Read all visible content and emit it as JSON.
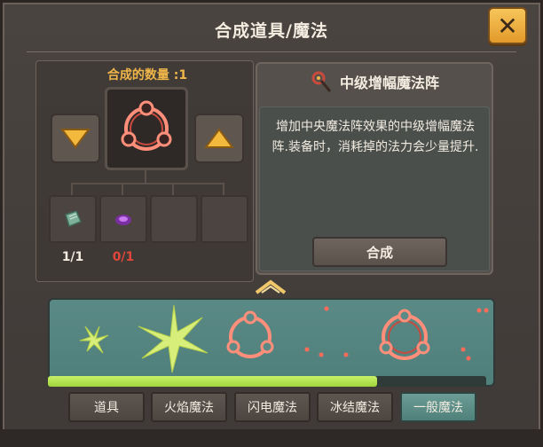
{
  "window": {
    "title": "合成道具/魔法"
  },
  "craft": {
    "quantity_label": "合成的数量 :1",
    "ingredients": [
      {
        "name": "parchment",
        "count": "1/1",
        "count_color": "#f1ebe0"
      },
      {
        "name": "purple-orb",
        "count": "0/1",
        "count_color": "#e0473a"
      },
      {
        "name": "empty-slot",
        "count": ""
      },
      {
        "name": "empty-slot",
        "count": ""
      }
    ]
  },
  "info": {
    "title": "中级增幅魔法阵",
    "description": "增加中央魔法阵效果的中级增幅魔法阵.装备时，消耗掉的法力会少量提升.",
    "compose_label": "合成"
  },
  "gallery": {
    "scroll_fraction": 0.75
  },
  "tabs": [
    {
      "label": "道具",
      "active": false
    },
    {
      "label": "火焰魔法",
      "active": false
    },
    {
      "label": "闪电魔法",
      "active": false
    },
    {
      "label": "冰结魔法",
      "active": false
    },
    {
      "label": "一般魔法",
      "active": true
    }
  ],
  "colors": {
    "accent_orange": "#f0b64a",
    "close_button": "#f6c55a",
    "scroll_thumb": "#b5e452",
    "circle_glow": "#ff8f7a"
  }
}
